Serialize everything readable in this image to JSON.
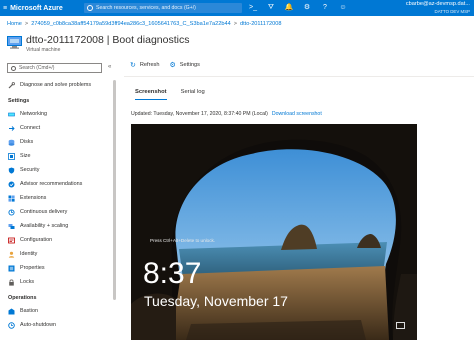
{
  "topbar": {
    "brand": "Microsoft Azure",
    "search_placeholder": "Search resources, services, and docs (G+/)",
    "icons": [
      "terminal-icon",
      "directory-filter-icon",
      "bell-icon",
      "gear-icon",
      "help-icon",
      "feedback-icon"
    ],
    "account_email": "cbarbe@az-devmsp.dat...",
    "account_directory": "DATTO DEV MSP"
  },
  "breadcrumb": [
    "Home",
    "274059_c0b8ca38aff54179a59d3ff94ea286c3_1605641763_C_S3ba1e7a22b44",
    "dtto-2011172008"
  ],
  "header": {
    "title": "dtto-2011172008 | Boot diagnostics",
    "subtitle": "Virtual machine"
  },
  "nav": {
    "search_placeholder": "Search (Cmd+/)",
    "collapse": "«",
    "top_items": [
      "Diagnose and solve problems"
    ],
    "settings_label": "Settings",
    "settings_items": [
      "Networking",
      "Connect",
      "Disks",
      "Size",
      "Security",
      "Advisor recommendations",
      "Extensions",
      "Continuous delivery",
      "Availability + scaling",
      "Configuration",
      "Identity",
      "Properties",
      "Locks"
    ],
    "operations_label": "Operations",
    "operations_items": [
      "Bastion",
      "Auto-shutdown"
    ]
  },
  "command_bar": {
    "refresh": "Refresh",
    "settings": "Settings"
  },
  "tabs": [
    "Screenshot",
    "Serial log"
  ],
  "updated": {
    "text": "Updated: Tuesday, November 17, 2020, 8:37:40 PM (Local)",
    "download": "Download screenshot"
  },
  "lockscreen": {
    "hint": "Press Ctrl+Alt+Delete to unlock.",
    "time": "8:37",
    "date": "Tuesday, November 17"
  },
  "colors": {
    "azure_blue": "#0078d4",
    "text": "#323130"
  }
}
